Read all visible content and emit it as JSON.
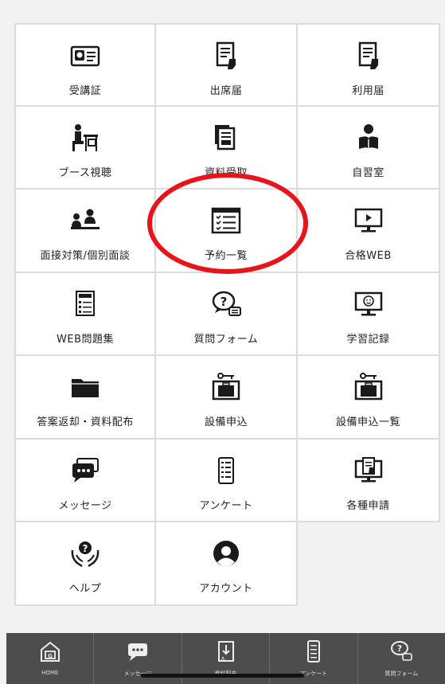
{
  "menu": [
    {
      "label": "受講証",
      "icon": "id-card-icon"
    },
    {
      "label": "出席届",
      "icon": "document-hand-icon"
    },
    {
      "label": "利用届",
      "icon": "document-hand-icon"
    },
    {
      "label": "ブース視聴",
      "icon": "study-booth-icon"
    },
    {
      "label": "資料受取",
      "icon": "documents-stack-icon"
    },
    {
      "label": "自習室",
      "icon": "reading-person-icon"
    },
    {
      "label": "面接対策/個別面談",
      "icon": "interview-icon"
    },
    {
      "label": "予約一覧",
      "icon": "checklist-window-icon"
    },
    {
      "label": "合格WEB",
      "icon": "video-monitor-icon"
    },
    {
      "label": "WEB問題集",
      "icon": "question-book-icon"
    },
    {
      "label": "質問フォーム",
      "icon": "question-bubble-icon"
    },
    {
      "label": "学習記録",
      "icon": "monitor-face-icon"
    },
    {
      "label": "答案返却・資料配布",
      "icon": "folder-icon"
    },
    {
      "label": "設備申込",
      "icon": "locker-key-icon"
    },
    {
      "label": "設備申込一覧",
      "icon": "locker-key-icon"
    },
    {
      "label": "メッセージ",
      "icon": "message-bubble-icon"
    },
    {
      "label": "アンケート",
      "icon": "survey-sheet-icon"
    },
    {
      "label": "各種申請",
      "icon": "application-monitor-icon"
    },
    {
      "label": "ヘルプ",
      "icon": "help-hands-icon"
    },
    {
      "label": "アカウント",
      "icon": "account-icon"
    }
  ],
  "tabbar": [
    {
      "label": "HOME",
      "icon": "home-icon"
    },
    {
      "label": "メッセージ",
      "icon": "message-bubble-icon"
    },
    {
      "label": "資料配布",
      "icon": "download-document-icon"
    },
    {
      "label": "アンケート",
      "icon": "survey-sheet-icon"
    },
    {
      "label": "質問フォーム",
      "icon": "question-bubble-icon"
    }
  ],
  "colors": {
    "highlight": "#e8141a",
    "tabbar": "#4d4d4d",
    "icon": "#1a1a1a"
  }
}
